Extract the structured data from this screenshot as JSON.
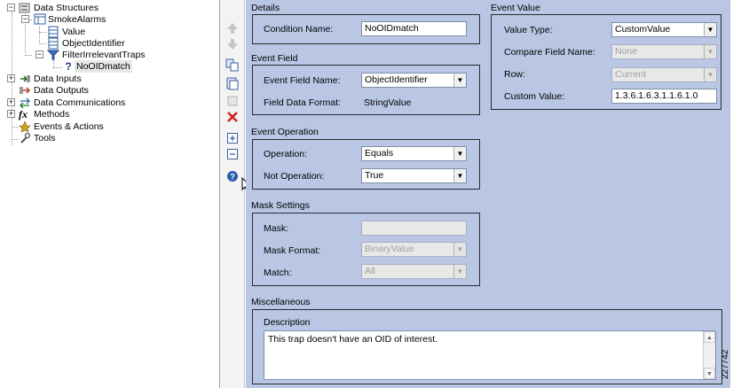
{
  "tree": {
    "items": [
      {
        "label": "Data Structures"
      },
      {
        "label": "SmokeAlarms"
      },
      {
        "label": "Value"
      },
      {
        "label": "ObjectIdentifier"
      },
      {
        "label": "FilterIrrelevantTraps"
      },
      {
        "label": "NoOIDmatch"
      },
      {
        "label": "Data Inputs"
      },
      {
        "label": "Data Outputs"
      },
      {
        "label": "Data Communications"
      },
      {
        "label": "Methods"
      },
      {
        "label": "Events & Actions"
      },
      {
        "label": "Tools"
      }
    ]
  },
  "details": {
    "section_title": "Details",
    "condition_name_label": "Condition Name:",
    "condition_name_value": "NoOIDmatch"
  },
  "event_field": {
    "section_title": "Event Field",
    "field_name_label": "Event Field Name:",
    "field_name_value": "ObjectIdentifier",
    "data_format_label": "Field Data Format:",
    "data_format_value": "StringValue"
  },
  "event_operation": {
    "section_title": "Event Operation",
    "operation_label": "Operation:",
    "operation_value": "Equals",
    "not_operation_label": "Not Operation:",
    "not_operation_value": "True"
  },
  "mask_settings": {
    "section_title": "Mask Settings",
    "mask_label": "Mask:",
    "mask_value": "",
    "mask_format_label": "Mask Format:",
    "mask_format_value": "BinaryValue",
    "match_label": "Match:",
    "match_value": "All"
  },
  "event_value": {
    "section_title": "Event Value",
    "value_type_label": "Value Type:",
    "value_type_value": "CustomValue",
    "compare_field_label": "Compare Field Name:",
    "compare_field_value": "None",
    "row_label": "Row:",
    "row_value": "Current",
    "custom_value_label": "Custom Value:",
    "custom_value_value": "1.3.6.1.6.3.1.1.6.1.0"
  },
  "misc": {
    "section_title": "Miscellaneous",
    "description_label": "Description",
    "description_value": "This trap doesn't have an OID of interest."
  },
  "figure_id": "227742",
  "colors": {
    "panel_bg": "#b9c6e4",
    "delete_red": "#d42020",
    "help_blue": "#2a5db0"
  }
}
